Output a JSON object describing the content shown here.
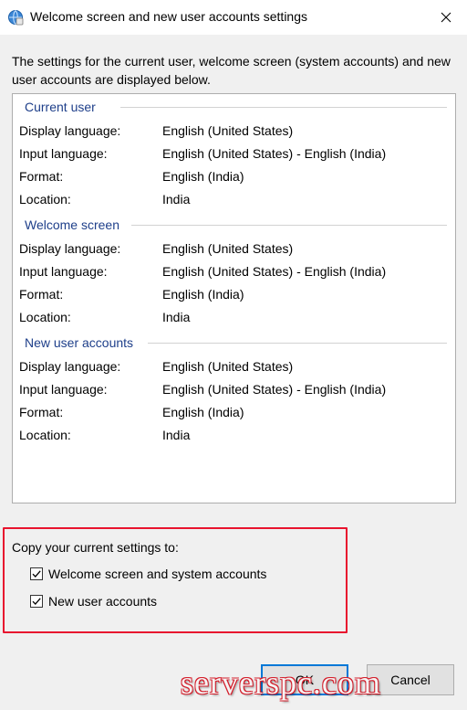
{
  "window": {
    "title": "Welcome screen and new user accounts settings",
    "icon": "globe-settings-icon"
  },
  "intro_text": "The settings for the current user, welcome screen (system accounts) and new user accounts are displayed below.",
  "sections": [
    {
      "title": "Current user",
      "rows": [
        {
          "label": "Display language:",
          "value": "English (United States)"
        },
        {
          "label": "Input language:",
          "value": "English (United States) - English (India)"
        },
        {
          "label": "Format:",
          "value": "English (India)"
        },
        {
          "label": "Location:",
          "value": "India"
        }
      ]
    },
    {
      "title": "Welcome screen",
      "rows": [
        {
          "label": "Display language:",
          "value": "English (United States)"
        },
        {
          "label": "Input language:",
          "value": "English (United States) - English (India)"
        },
        {
          "label": "Format:",
          "value": "English (India)"
        },
        {
          "label": "Location:",
          "value": "India"
        }
      ]
    },
    {
      "title": "New user accounts",
      "rows": [
        {
          "label": "Display language:",
          "value": "English (United States)"
        },
        {
          "label": "Input language:",
          "value": "English (United States) - English (India)"
        },
        {
          "label": "Format:",
          "value": "English (India)"
        },
        {
          "label": "Location:",
          "value": "India"
        }
      ]
    }
  ],
  "copy": {
    "label": "Copy your current settings to:",
    "options": [
      {
        "label": "Welcome screen and system accounts",
        "checked": true
      },
      {
        "label": "New user accounts",
        "checked": true
      }
    ]
  },
  "buttons": {
    "ok": "OK",
    "cancel": "Cancel"
  },
  "watermark": "serverspc.com",
  "colors": {
    "accent": "#0078d7",
    "section_title": "#1e3f8a",
    "highlight": "#e8132e"
  }
}
